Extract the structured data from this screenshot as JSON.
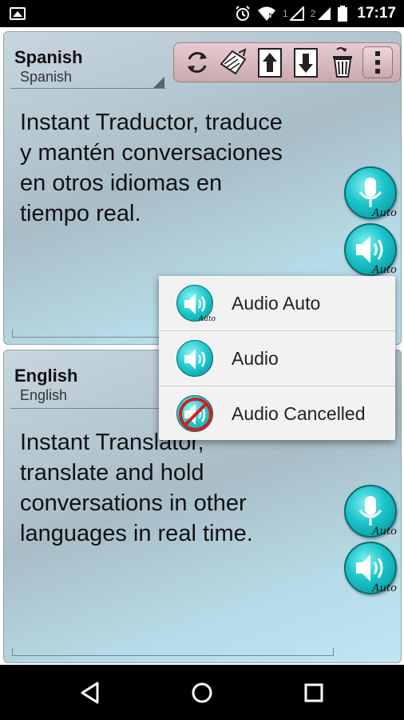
{
  "status_bar": {
    "sim1": "1",
    "sim2": "2",
    "time": "17:17",
    "icons": [
      "image-icon",
      "alarm-icon",
      "wifi-icon",
      "signal-icon",
      "battery-icon"
    ]
  },
  "toolbar": {
    "buttons": [
      "refresh-icon",
      "send-icon",
      "upload-icon",
      "download-icon",
      "trash-icon",
      "overflow-menu-icon"
    ]
  },
  "top_panel": {
    "language_title": "Spanish",
    "language_sub": "Spanish",
    "text_lines": [
      "Instant Traductor, traduce",
      "y  mantén conversaciones",
      "en otros idiomas en",
      "tiempo real."
    ],
    "mic_auto_label": "Auto",
    "speaker_auto_label": "Auto"
  },
  "bottom_panel": {
    "language_title": "English",
    "language_sub": "English",
    "text_lines": [
      "Instant Translator,",
      "translate and hold",
      "conversations in other",
      "languages in real time."
    ],
    "mic_auto_label": "Auto",
    "speaker_auto_label": "Auto"
  },
  "popup_menu": {
    "items": [
      {
        "label": "Audio Auto",
        "icon": "speaker-auto-icon",
        "badge": "Auto"
      },
      {
        "label": "Audio",
        "icon": "speaker-icon"
      },
      {
        "label": "Audio Cancelled",
        "icon": "speaker-cancelled-icon"
      }
    ]
  },
  "colors": {
    "accent": "#19c3c9",
    "toolbar_bg": "#dcbfc4",
    "cancel_red": "#d22020"
  }
}
